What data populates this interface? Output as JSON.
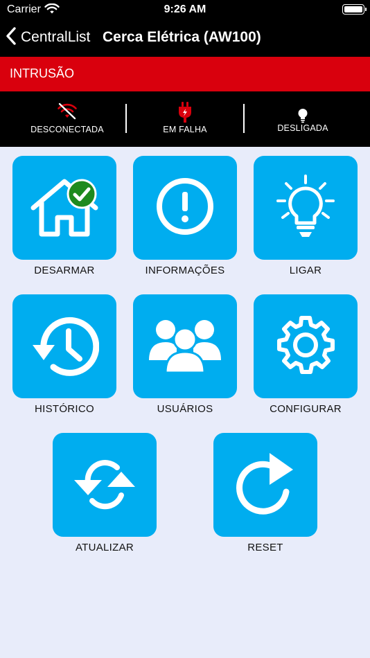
{
  "status_bar": {
    "carrier": "Carrier",
    "time": "9:26 AM"
  },
  "nav": {
    "back_label": "CentralList",
    "title": "Cerca Elétrica (AW100)"
  },
  "alarm": {
    "text": "INTRUSÃO",
    "color": "#d9000d"
  },
  "status": [
    {
      "icon": "wifi-off-icon",
      "label": "DESCONECTADA"
    },
    {
      "icon": "plug-fault-icon",
      "label": "EM FALHA"
    },
    {
      "icon": "lightbulb-icon",
      "label": "DESLIGADA"
    }
  ],
  "tiles": [
    {
      "icon": "home-check-icon",
      "label": "DESARMAR"
    },
    {
      "icon": "info-exclamation-icon",
      "label": "INFORMAÇÕES"
    },
    {
      "icon": "lightbulb-icon",
      "label": "LIGAR"
    },
    {
      "icon": "history-icon",
      "label": "HISTÓRICO"
    },
    {
      "icon": "users-icon",
      "label": "USUÁRIOS"
    },
    {
      "icon": "gear-icon",
      "label": "CONFIGURAR"
    },
    {
      "icon": "refresh-icon",
      "label": "ATUALIZAR"
    },
    {
      "icon": "reset-icon",
      "label": "RESET"
    }
  ],
  "colors": {
    "tile": "#00adef",
    "background": "#e8ecfa",
    "check_badge": "#1e8a1e"
  }
}
